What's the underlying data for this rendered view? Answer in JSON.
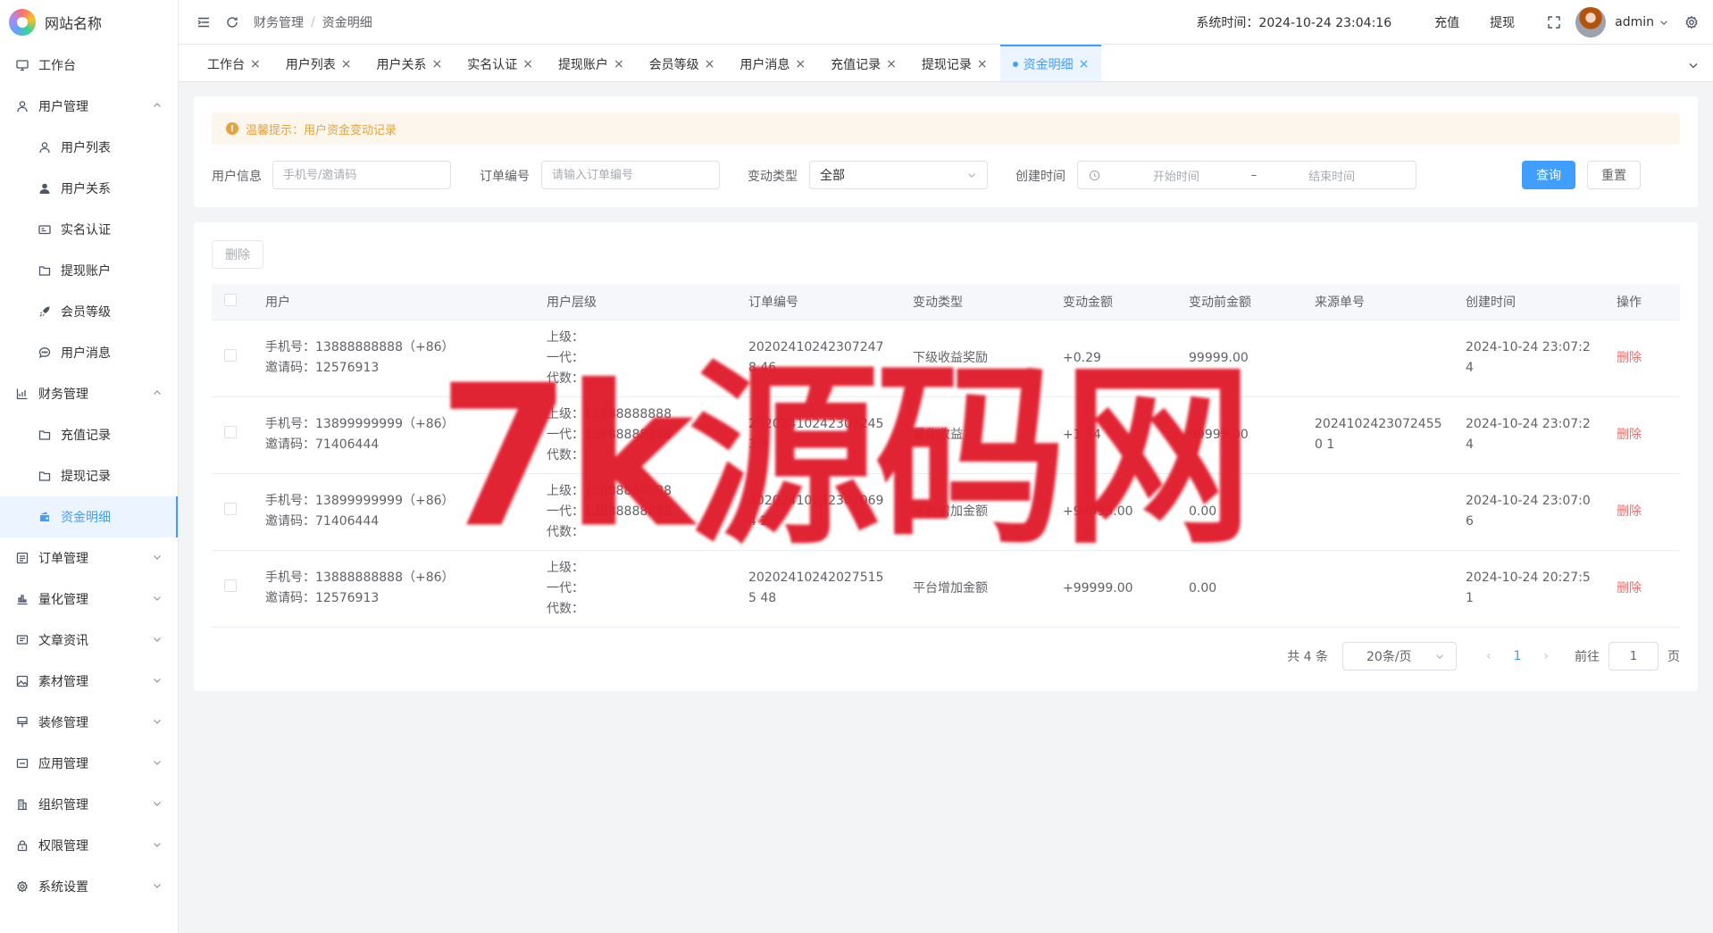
{
  "site": {
    "name": "网站名称"
  },
  "sidebar": {
    "items": [
      {
        "label": "工作台",
        "icon": "monitor-icon"
      },
      {
        "label": "用户管理",
        "icon": "user-icon",
        "expanded": true
      },
      {
        "label": "用户列表",
        "icon": "user-outline-icon"
      },
      {
        "label": "用户关系",
        "icon": "user-solid-icon"
      },
      {
        "label": "实名认证",
        "icon": "id-card-icon"
      },
      {
        "label": "提现账户",
        "icon": "folder-icon"
      },
      {
        "label": "会员等级",
        "icon": "rocket-icon"
      },
      {
        "label": "用户消息",
        "icon": "chat-icon"
      },
      {
        "label": "财务管理",
        "icon": "chart-icon",
        "expanded": true
      },
      {
        "label": "充值记录",
        "icon": "folder-icon"
      },
      {
        "label": "提现记录",
        "icon": "folder-icon"
      },
      {
        "label": "资金明细",
        "icon": "wallet-icon",
        "active": true
      },
      {
        "label": "订单管理",
        "icon": "list-icon"
      },
      {
        "label": "量化管理",
        "icon": "bars-icon"
      },
      {
        "label": "文章资讯",
        "icon": "doc-icon"
      },
      {
        "label": "素材管理",
        "icon": "image-icon"
      },
      {
        "label": "装修管理",
        "icon": "brush-icon"
      },
      {
        "label": "应用管理",
        "icon": "app-icon"
      },
      {
        "label": "组织管理",
        "icon": "org-icon"
      },
      {
        "label": "权限管理",
        "icon": "lock-icon"
      },
      {
        "label": "系统设置",
        "icon": "gear-icon"
      }
    ]
  },
  "header": {
    "breadcrumb": [
      "财务管理",
      "资金明细"
    ],
    "system_time": "系统时间：2024-10-24 23:04:16",
    "recharge": "充值",
    "withdraw": "提现",
    "username": "admin"
  },
  "tabs": [
    {
      "label": "工作台"
    },
    {
      "label": "用户列表"
    },
    {
      "label": "用户关系"
    },
    {
      "label": "实名认证"
    },
    {
      "label": "提现账户"
    },
    {
      "label": "会员等级"
    },
    {
      "label": "用户消息"
    },
    {
      "label": "充值记录"
    },
    {
      "label": "提现记录"
    },
    {
      "label": "资金明细",
      "active": true
    }
  ],
  "filter": {
    "tip": "温馨提示：用户资金变动记录",
    "user_label": "用户信息",
    "user_placeholder": "手机号/邀请码",
    "order_label": "订单编号",
    "order_placeholder": "请输入订单编号",
    "type_label": "变动类型",
    "type_value": "全部",
    "time_label": "创建时间",
    "start_placeholder": "开始时间",
    "range_sep": "–",
    "end_placeholder": "结束时间",
    "query": "查询",
    "reset": "重置"
  },
  "table": {
    "delete_btn": "删除",
    "columns": [
      "用户",
      "用户层级",
      "订单编号",
      "变动类型",
      "变动金额",
      "变动前金额",
      "来源单号",
      "创建时间",
      "操作"
    ],
    "rows": [
      {
        "phone": "手机号：13888888888（+86）",
        "code": "邀请码：12576913",
        "level1": "上级：",
        "level2": "一代：",
        "level3": "代数：",
        "order": "202024102423072478 46",
        "type": "下级收益奖励",
        "amount": "+0.29",
        "before": "99999.00",
        "source": "",
        "time": "2024-10-24 23:07:2 4",
        "op": "删除"
      },
      {
        "phone": "手机号：13899999999（+86）",
        "code": "邀请码：71406444",
        "level1": "上级：13888888888",
        "level2": "一代：13888888888",
        "level3": "代数：",
        "order": "202024102423072453 9",
        "type": "量化收益",
        "amount": "+1.84",
        "before": "99999.00",
        "source": "20241024230724550 1",
        "time": "2024-10-24 23:07:2 4",
        "op": "删除"
      },
      {
        "phone": "手机号：13899999999（+86）",
        "code": "邀请码：71406444",
        "level1": "上级：13888888888",
        "level2": "一代：13888888888",
        "level3": "代数：",
        "order": "202024102423070694 2",
        "type": "平台增加金额",
        "amount": "+99999.00",
        "before": "0.00",
        "source": "",
        "time": "2024-10-24 23:07:0 6",
        "op": "删除"
      },
      {
        "phone": "手机号：13888888888（+86）",
        "code": "邀请码：12576913",
        "level1": "上级：",
        "level2": "一代：",
        "level3": "代数：",
        "order": "202024102420275155 48",
        "type": "平台增加金额",
        "amount": "+99999.00",
        "before": "0.00",
        "source": "",
        "time": "2024-10-24 20:27:5 1",
        "op": "删除"
      }
    ]
  },
  "pagination": {
    "total": "共 4 条",
    "page_size": "20条/页",
    "current": "1",
    "goto_label": "前往",
    "goto_value": "1",
    "page_unit": "页"
  },
  "watermark": "7k源码网",
  "colors": {
    "primary": "#409eff",
    "danger": "#f56c6c",
    "warning": "#e6a23c",
    "watermark": "#e11d2e"
  }
}
